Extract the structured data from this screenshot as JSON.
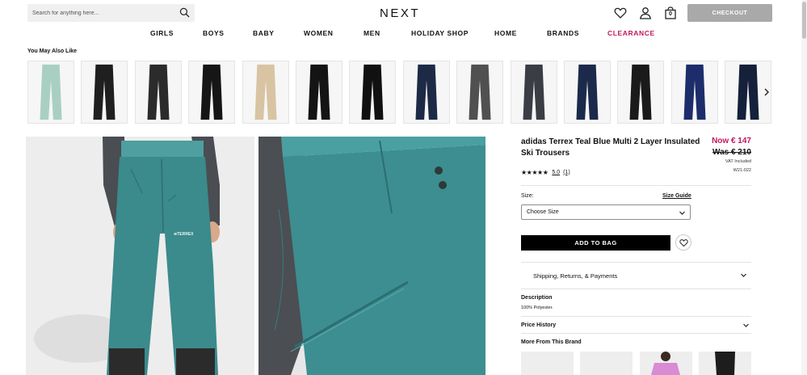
{
  "header": {
    "search_placeholder": "Search for anything here...",
    "logo": "NEXT",
    "bag_count": "0",
    "checkout_label": "CHECKOUT"
  },
  "nav": {
    "items": [
      "GIRLS",
      "BOYS",
      "BABY",
      "WOMEN",
      "MEN",
      "HOLIDAY SHOP",
      "HOME",
      "BRANDS",
      "CLEARANCE"
    ]
  },
  "carousel": {
    "title": "You May Also Like",
    "thumbs": [
      {
        "color": "#a9cfc3"
      },
      {
        "color": "#1f1f1f"
      },
      {
        "color": "#2b2b2b"
      },
      {
        "color": "#161616"
      },
      {
        "color": "#d8c4a2"
      },
      {
        "color": "#141414"
      },
      {
        "color": "#111111"
      },
      {
        "color": "#1c2a46"
      },
      {
        "color": "#505050"
      },
      {
        "color": "#3a3d44"
      },
      {
        "color": "#1b2a4b"
      },
      {
        "color": "#1a1a1a"
      },
      {
        "color": "#1d2d6b"
      },
      {
        "color": "#15203a"
      }
    ]
  },
  "product": {
    "title": "adidas Terrex Teal Blue Multi 2 Layer Insulated Ski Trousers",
    "price_now": "Now € 147",
    "price_was": "Was € 210",
    "vat": "VAT Included",
    "sku": "W21-022",
    "stars": "★★★★★",
    "rating": "5.0",
    "rating_count": "(1)",
    "color": "#3b8a8c",
    "size_label": "Size:",
    "size_guide": "Size Guide",
    "size_select": "Choose Size",
    "add_to_bag": "ADD TO BAG",
    "shipping": "Shipping, Returns, & Payments",
    "description_title": "Description",
    "description_text": "100% Polyester.",
    "price_history": "Price History",
    "more_from_brand": "More From This Brand"
  }
}
